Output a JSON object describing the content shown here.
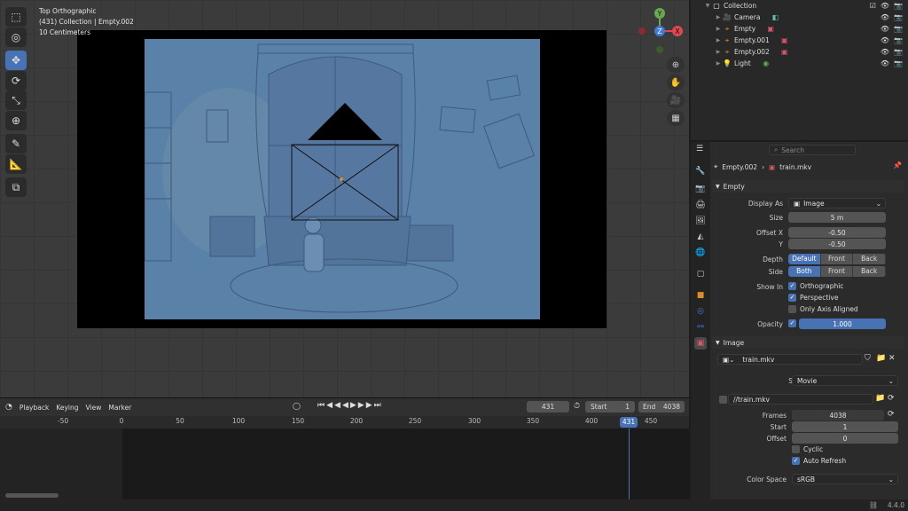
{
  "viewport": {
    "view_name": "Top Orthographic",
    "collection_line": "(431) Collection | Empty.002",
    "scale": "10 Centimeters",
    "gizmo": {
      "y": "Y",
      "x": "X",
      "z": "Z"
    }
  },
  "timeline": {
    "menu": {
      "playback": "Playback",
      "keying": "Keying",
      "view": "View",
      "marker": "Marker"
    },
    "current_frame": "431",
    "start_label": "Start",
    "start_value": "1",
    "end_label": "End",
    "end_value": "4038",
    "ticks": [
      "-50",
      "0",
      "50",
      "100",
      "150",
      "200",
      "250",
      "300",
      "350",
      "400",
      "450"
    ],
    "playhead": "431"
  },
  "outliner": {
    "items": [
      {
        "label": "Collection",
        "icon": "collection-icon"
      },
      {
        "label": "Camera",
        "icon": "camera-icon"
      },
      {
        "label": "Empty",
        "icon": "empty-icon"
      },
      {
        "label": "Empty.001",
        "icon": "empty-icon"
      },
      {
        "label": "Empty.002",
        "icon": "empty-icon"
      },
      {
        "label": "Light",
        "icon": "light-icon"
      }
    ]
  },
  "properties": {
    "search_placeholder": "Search",
    "breadcrumb": {
      "object": "Empty.002",
      "data": "train.mkv"
    },
    "empty_panel": {
      "title": "Empty",
      "display_as_label": "Display As",
      "display_as_value": "Image",
      "size_label": "Size",
      "size_value": "5 m",
      "offset_x_label": "Offset X",
      "offset_x_value": "-0.50",
      "offset_y_label": "Y",
      "offset_y_value": "-0.50",
      "depth_label": "Depth",
      "depth_options": [
        "Default",
        "Front",
        "Back"
      ],
      "side_label": "Side",
      "side_options": [
        "Both",
        "Front",
        "Back"
      ],
      "show_in_label": "Show In",
      "orthographic": "Orthographic",
      "perspective": "Perspective",
      "only_axis_aligned": "Only Axis Aligned",
      "opacity_label": "Opacity",
      "opacity_value": "1.000"
    },
    "image_panel": {
      "title": "Image",
      "image_name": "train.mkv",
      "source_label": "Source",
      "source_value": "Movie",
      "filepath": "//train.mkv",
      "frames_label": "Frames",
      "frames_value": "4038",
      "start_label": "Start",
      "start_value": "1",
      "offset_label": "Offset",
      "offset_value": "0",
      "cyclic": "Cyclic",
      "auto_refresh": "Auto Refresh",
      "color_space_label": "Color Space",
      "color_space_value": "sRGB"
    }
  },
  "statusbar": {
    "version": "4.4.0"
  },
  "colors": {
    "accent": "#4772b3",
    "playhead": "#4772b3",
    "x_axis": "#e0474f",
    "y_axis": "#6aa84f",
    "z_axis": "#3d7bd9"
  }
}
